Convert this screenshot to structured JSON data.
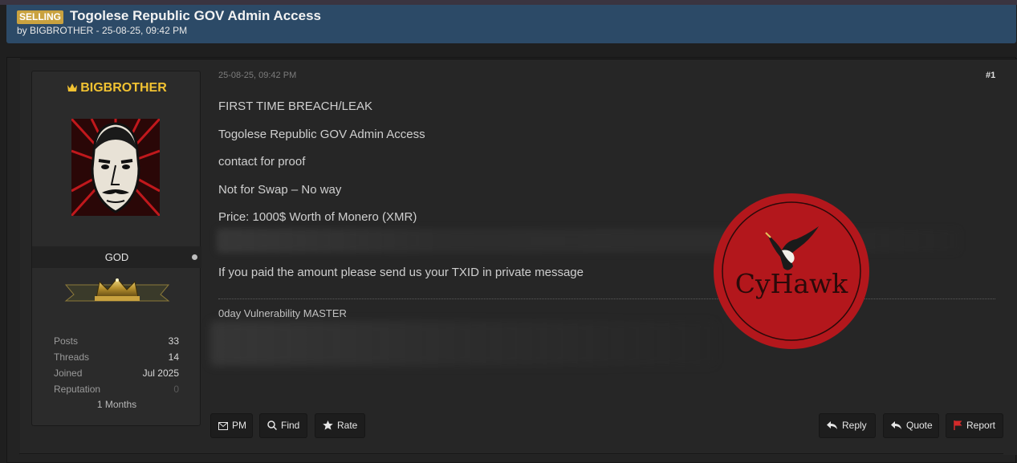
{
  "thread": {
    "prefix": "SELLING",
    "title": "Togolese Republic GOV Admin Access",
    "byline": "by BIGBROTHER - 25-08-25, 09:42 PM"
  },
  "user": {
    "name": "BIGBROTHER",
    "rank": "GOD",
    "stats": [
      {
        "label": "Posts",
        "value": "33"
      },
      {
        "label": "Threads",
        "value": "14"
      },
      {
        "label": "Joined",
        "value": "Jul 2025"
      },
      {
        "label": "Reputation",
        "value": "0"
      }
    ],
    "membership": "1 Months"
  },
  "post": {
    "date": "25-08-25, 09:42 PM",
    "number": "#1",
    "lines": [
      "FIRST TIME BREACH/LEAK",
      "Togolese Republic GOV Admin Access",
      "contact for proof",
      "Not for Swap – No way",
      "Price: 1000$ Worth of Monero (XMR)",
      "If you paid the amount please send us your TXID in private message"
    ],
    "signature": "0day Vulnerability MASTER"
  },
  "watermark": {
    "text": "CyHawk"
  },
  "actions": {
    "pm": "PM",
    "find": "Find",
    "rate": "Rate",
    "reply": "Reply",
    "quote": "Quote",
    "report": "Report"
  },
  "colors": {
    "header_bg": "#2c4a67",
    "badge": "#c9a23f",
    "username": "#f1c232",
    "watermark_red": "#b3171c",
    "report_flag": "#d42a2a"
  }
}
